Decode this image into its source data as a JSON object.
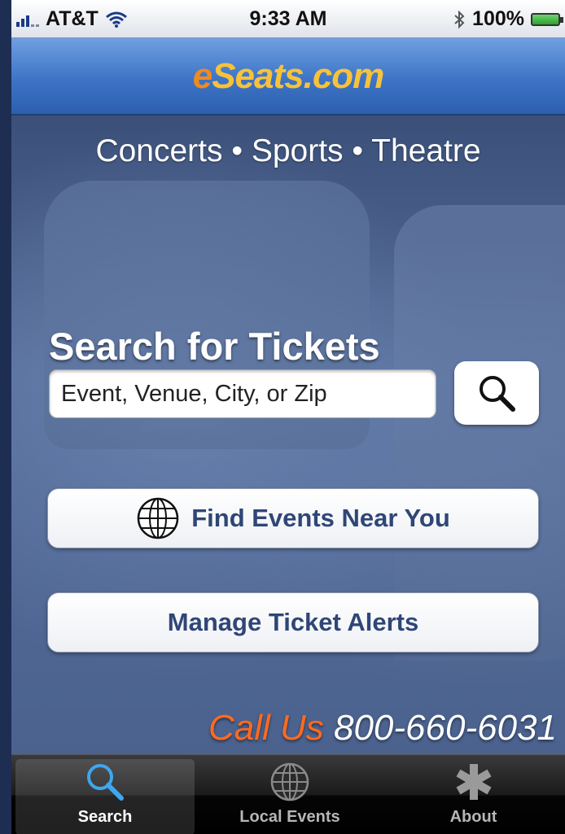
{
  "status_bar": {
    "carrier": "AT&T",
    "time": "9:33 AM",
    "battery": "100%",
    "icons": [
      "signal-icon",
      "wifi-icon",
      "bluetooth-icon",
      "battery-icon"
    ]
  },
  "header": {
    "logo_part1": "e",
    "logo_part2": "Seats.com"
  },
  "main": {
    "tagline": "Concerts • Sports • Theatre",
    "search_title": "Search for Tickets",
    "search_placeholder": "Event, Venue, City, or Zip",
    "find_events_label": "Find Events Near You",
    "manage_alerts_label": "Manage Ticket Alerts",
    "call_us_label": "Call Us",
    "phone_number": "800-660-6031"
  },
  "tabs": [
    {
      "label": "Search",
      "icon": "search-icon",
      "active": true
    },
    {
      "label": "Local Events",
      "icon": "globe-icon",
      "active": false
    },
    {
      "label": "About",
      "icon": "asterisk-icon",
      "active": false
    }
  ],
  "colors": {
    "accent_orange": "#f08a1e",
    "button_text": "#2f4676",
    "header_blue": "#3d74c6"
  }
}
